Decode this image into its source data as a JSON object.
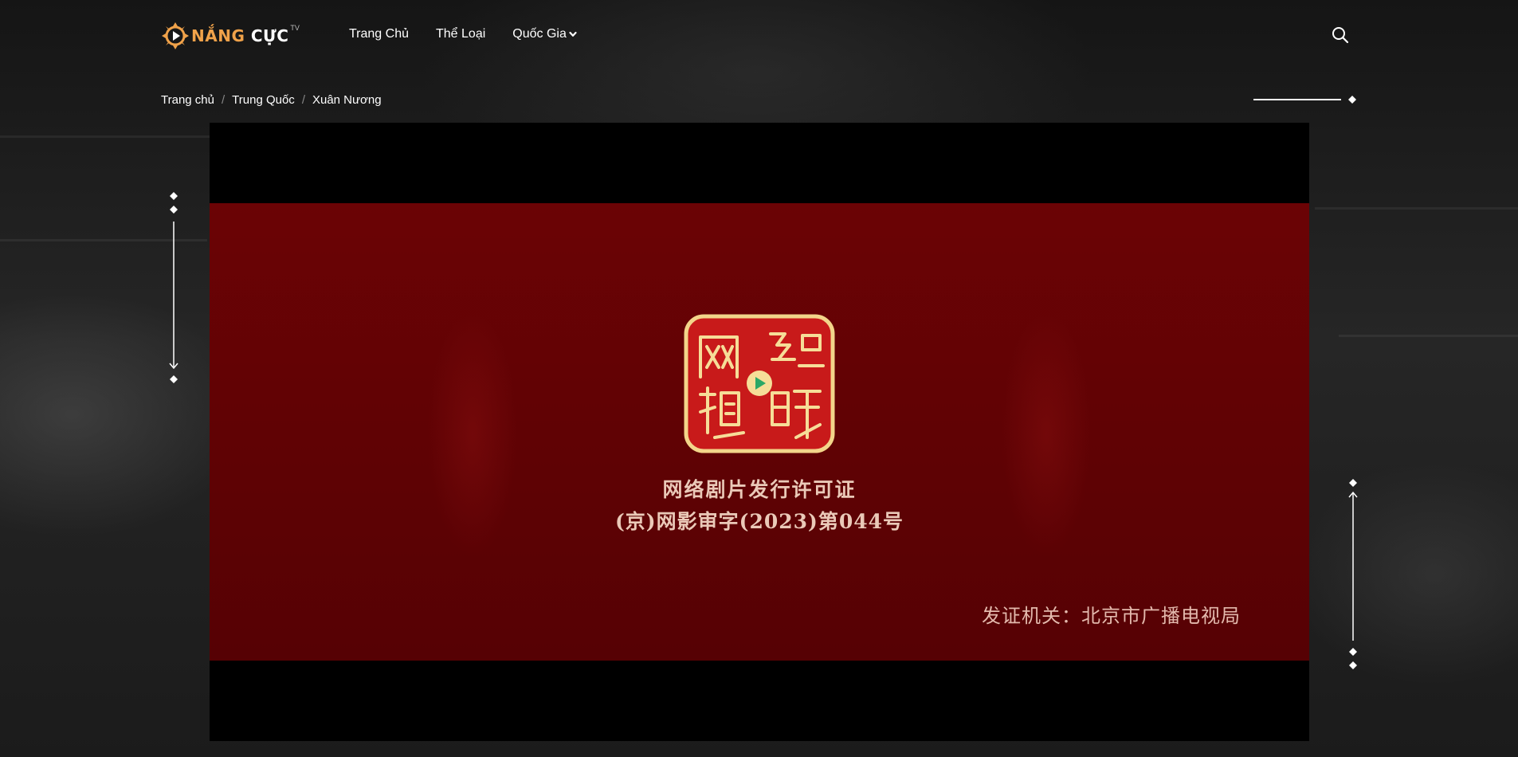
{
  "brand": {
    "name_part1": "NẮNG",
    "name_part2": " CỰC",
    "suffix": "TV",
    "accent_color": "#f0a24a"
  },
  "nav": {
    "items": [
      {
        "label": "Trang Chủ"
      },
      {
        "label": "Thể Loại"
      },
      {
        "label": "Quốc Gia",
        "has_dropdown": true
      }
    ]
  },
  "header": {
    "search_icon": "search-icon"
  },
  "breadcrumb": {
    "items": [
      "Trang chủ",
      "Trung Quốc",
      "Xuân Nương"
    ],
    "separator": "/"
  },
  "video": {
    "license_line1": "网络剧片发行许可证",
    "license_line2": "(京)网影审字(2023)第044号",
    "issuer": "发证机关：北京市广播电视局",
    "seal_text": "网络视听",
    "frame_color": "#5e0204",
    "seal_color": "#c81a1a",
    "text_color": "#eac9b8"
  }
}
